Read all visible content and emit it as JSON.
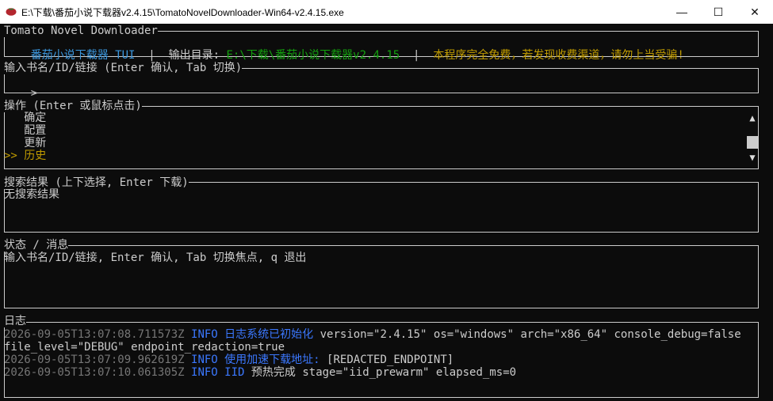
{
  "window": {
    "title": "E:\\下载\\番茄小说下载器v2.4.15\\TomatoNovelDownloader-Win64-v2.4.15.exe",
    "minimize_glyph": "—",
    "maximize_glyph": "☐",
    "close_glyph": "✕"
  },
  "header": {
    "frame_title": "Tomato Novel Downloader",
    "app_name": "番茄小说下载器 TUI",
    "sep": "|",
    "output_label": "输出目录:",
    "output_path": "E:\\下载\\番茄小说下载器v2.4.15",
    "notice": "本程序完全免费，若发现收费渠道，请勿上当受骗!"
  },
  "input": {
    "frame_title": "输入书名/ID/链接 (Enter 确认, Tab 切换)",
    "prompt": ">",
    "value": ""
  },
  "actions": {
    "frame_title": "操作 (Enter 或鼠标点击)",
    "items": [
      {
        "label": "确定",
        "prefix": "   "
      },
      {
        "label": "配置",
        "prefix": "   "
      },
      {
        "label": "更新",
        "prefix": "   "
      },
      {
        "label": "历史",
        "prefix": ">> "
      }
    ],
    "selected_index": 3,
    "scroll_up": "▲",
    "scroll_down": "▼"
  },
  "results": {
    "frame_title": "搜索结果 (上下选择, Enter 下载)",
    "empty_text": "无搜索结果"
  },
  "status": {
    "frame_title": "状态 / 消息",
    "message": "输入书名/ID/链接, Enter 确认, Tab 切换焦点, q 退出"
  },
  "log": {
    "frame_title": "日志",
    "entries": [
      {
        "ts": "2026-09-05T13:07:08.711573Z",
        "level": "INFO",
        "msg": "日志系统已初始化",
        "fields": "version=\"2.4.15\" os=\"windows\" arch=\"x86_64\" console_debug=false",
        "wrap": "file_level=\"DEBUG\" endpoint_redaction=true"
      },
      {
        "ts": "2026-09-05T13:07:09.962619Z",
        "level": "INFO",
        "msg": "使用加速下载地址:",
        "fields": "[REDACTED_ENDPOINT]"
      },
      {
        "ts": "2026-09-05T13:07:10.061305Z",
        "level": "INFO",
        "msg": "IID",
        "fields": "预热完成 stage=\"iid_prewarm\" elapsed_ms=0"
      }
    ]
  },
  "colors": {
    "background": "#0c0c0c",
    "foreground": "#cccccc",
    "cyan": "#3a96dd",
    "green": "#13a10e",
    "yellow": "#c19c00",
    "grey": "#767676",
    "blue": "#3b78ff"
  }
}
